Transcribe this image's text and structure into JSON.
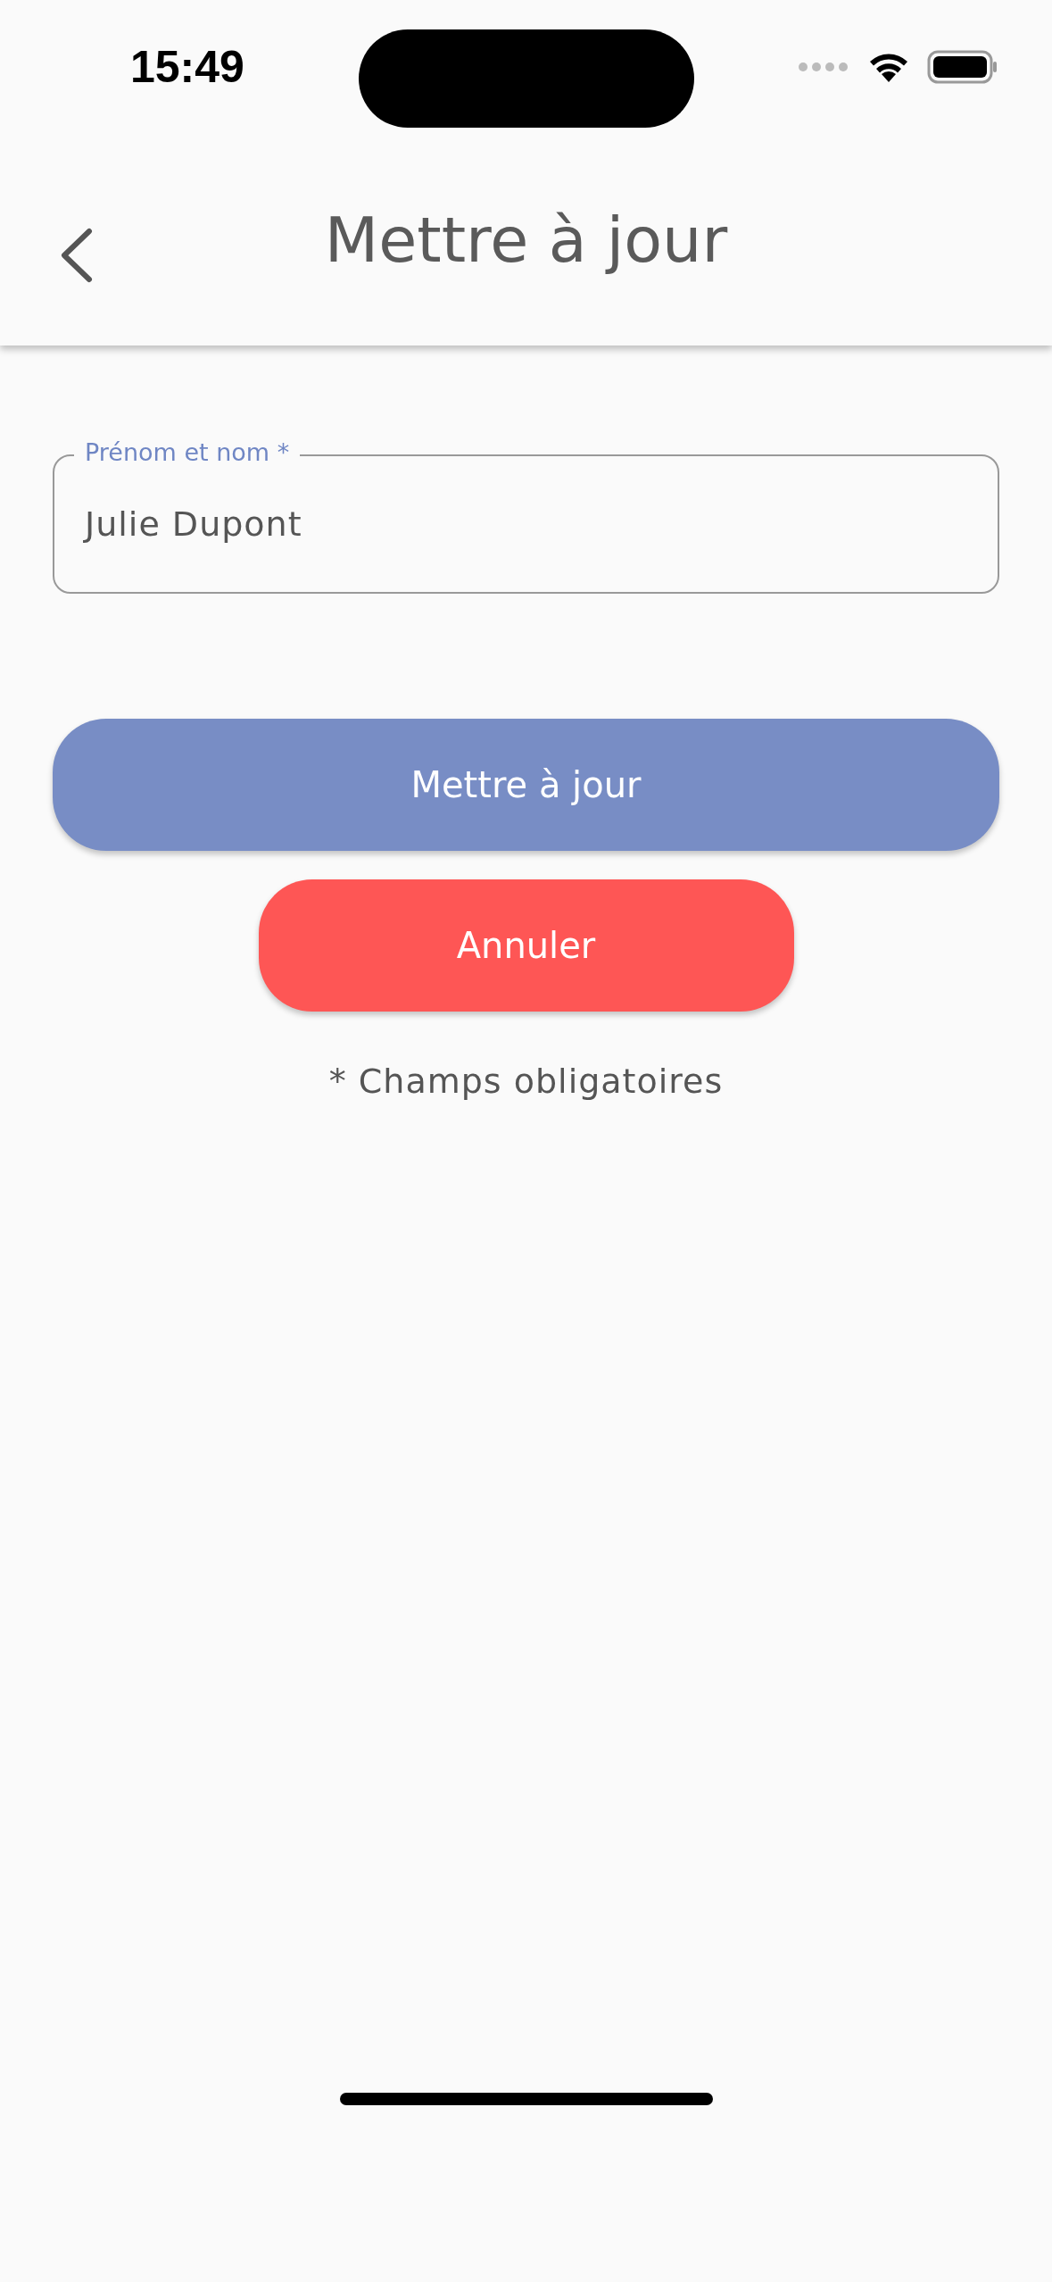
{
  "status_bar": {
    "time": "15:49"
  },
  "header": {
    "title": "Mettre à jour"
  },
  "form": {
    "fields": [
      {
        "label": "Prénom et nom *",
        "value": "Julie Dupont"
      }
    ]
  },
  "buttons": [
    {
      "label": "Mettre à jour",
      "kind": "primary"
    },
    {
      "label": "Annuler",
      "kind": "danger"
    }
  ],
  "footnote": "* Champs obligatoires"
}
